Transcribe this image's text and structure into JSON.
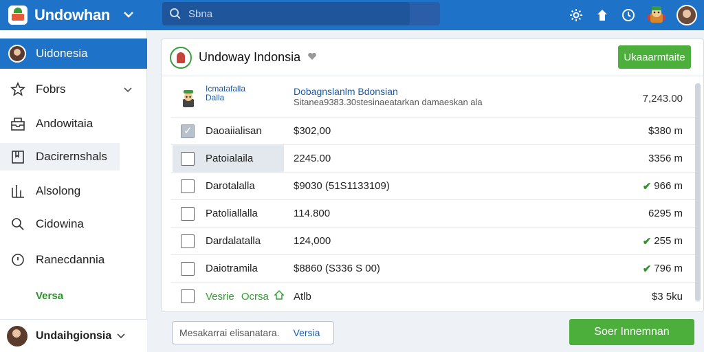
{
  "app": {
    "brand_name": "Undowhan",
    "search_placeholder": "Sbna"
  },
  "sidebar": {
    "active_label": "Uidonesia",
    "items": [
      {
        "label": "Fobrs",
        "icon": "star-icon",
        "has_chevron": true
      },
      {
        "label": "Andowitaia",
        "icon": "inbox-icon"
      },
      {
        "label": "Dacirernshals",
        "icon": "document-icon"
      },
      {
        "label": "Alsolong",
        "icon": "chart-icon"
      },
      {
        "label": "Cidowina",
        "icon": "search-icon"
      },
      {
        "label": "Ranecdannia",
        "icon": "clock-icon"
      }
    ],
    "versa_label": "Versa",
    "footer_name": "Undaihgionsia"
  },
  "panel": {
    "title": "Undoway Indonsia",
    "action_button": "Ukaaarmtaite",
    "header_row": {
      "c1": "Icmatafalla",
      "c1_sub": "Dalla",
      "c2_title": "Dobagnslanlm Bdonsian",
      "c2_sub": "Sitanea9383.30stesinaeatarkan damaeskan ala",
      "c3": "7,243.00"
    },
    "rows": [
      {
        "c1": "Daoaiialisan",
        "c2": "$302,00",
        "c3": "$380 m",
        "checked": true,
        "highlight": false,
        "check_mark": false,
        "amount_yellow": true
      },
      {
        "c1": "Patoialaila",
        "c2": "2245.00",
        "c3": "3356 m",
        "checked": false,
        "highlight": true,
        "check_mark": false,
        "amount_yellow": false
      },
      {
        "c1": "Darotalalla",
        "c2": "$9030 (51S1133109)",
        "c3": "966 m",
        "checked": false,
        "highlight": false,
        "check_mark": true,
        "amount_yellow": false
      },
      {
        "c1": "Patoliallalla",
        "c2": "114.800",
        "c3": "6295 m",
        "checked": false,
        "highlight": false,
        "check_mark": false,
        "amount_yellow": false
      },
      {
        "c1": "Dardalatalla",
        "c2": "124,000",
        "c3": "255 m",
        "checked": false,
        "highlight": false,
        "check_mark": true,
        "amount_yellow": false
      },
      {
        "c1": "Daiotramila",
        "c2": "$8860 (S336 S 00)",
        "c3": "796 m",
        "checked": false,
        "highlight": false,
        "check_mark": true,
        "amount_yellow": false
      }
    ],
    "last_row": {
      "c1": "Vesrie",
      "c1b": "Ocrsa",
      "c2": "Atlb",
      "c3": "$3 5ku"
    }
  },
  "bottom": {
    "input_placeholder": "Mesakarrai elisanatara.",
    "input_link": "Versia",
    "submit_button": "Soer Innemnan"
  },
  "colors": {
    "accent_blue": "#1e73c8",
    "accent_green": "#4caf3c",
    "link_blue": "#1a5ca8"
  }
}
